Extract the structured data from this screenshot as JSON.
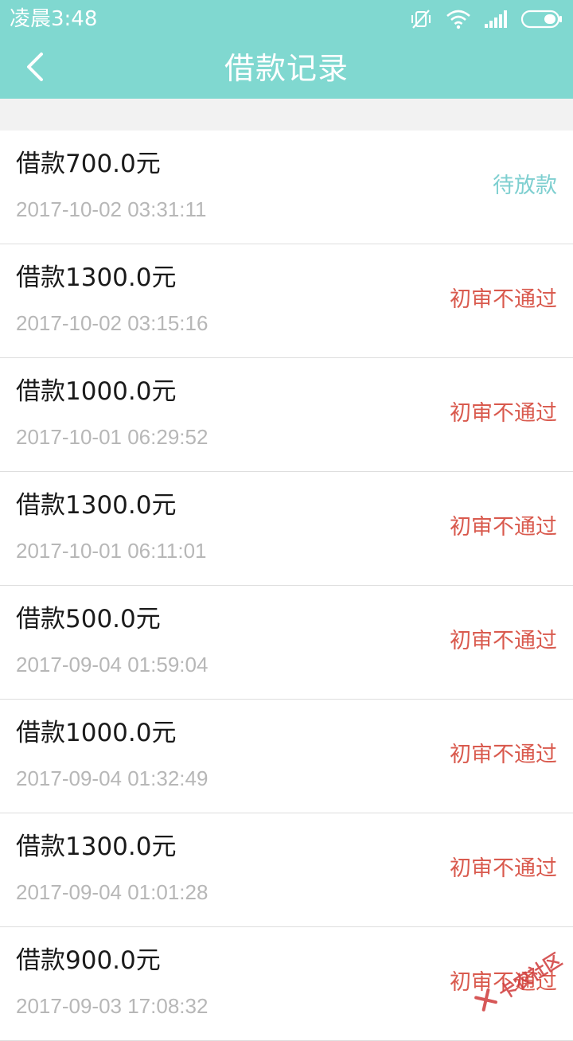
{
  "status_bar": {
    "time": "凌晨3:48",
    "icons": [
      "vibrate-off-icon",
      "wifi-icon",
      "signal-icon",
      "battery-icon"
    ]
  },
  "header": {
    "back_icon": "chevron-left-icon",
    "title": "借款记录",
    "background": "#80d8d0"
  },
  "colors": {
    "pending": "#7ecfd0",
    "rejected": "#d95a4e"
  },
  "records": [
    {
      "title": "借款700.0元",
      "time": "2017-10-02 03:31:11",
      "status": "待放款",
      "status_type": "pending"
    },
    {
      "title": "借款1300.0元",
      "time": "2017-10-02 03:15:16",
      "status": "初审不通过",
      "status_type": "rejected"
    },
    {
      "title": "借款1000.0元",
      "time": "2017-10-01 06:29:52",
      "status": "初审不通过",
      "status_type": "rejected"
    },
    {
      "title": "借款1300.0元",
      "time": "2017-10-01 06:11:01",
      "status": "初审不通过",
      "status_type": "rejected"
    },
    {
      "title": "借款500.0元",
      "time": "2017-09-04 01:59:04",
      "status": "初审不通过",
      "status_type": "rejected"
    },
    {
      "title": "借款1000.0元",
      "time": "2017-09-04 01:32:49",
      "status": "初审不通过",
      "status_type": "rejected"
    },
    {
      "title": "借款1300.0元",
      "time": "2017-09-04 01:01:28",
      "status": "初审不通过",
      "status_type": "rejected"
    },
    {
      "title": "借款900.0元",
      "time": "2017-09-03 17:08:32",
      "status": "初审不通过",
      "status_type": "rejected"
    }
  ],
  "watermark": {
    "text": "卡农社区"
  }
}
